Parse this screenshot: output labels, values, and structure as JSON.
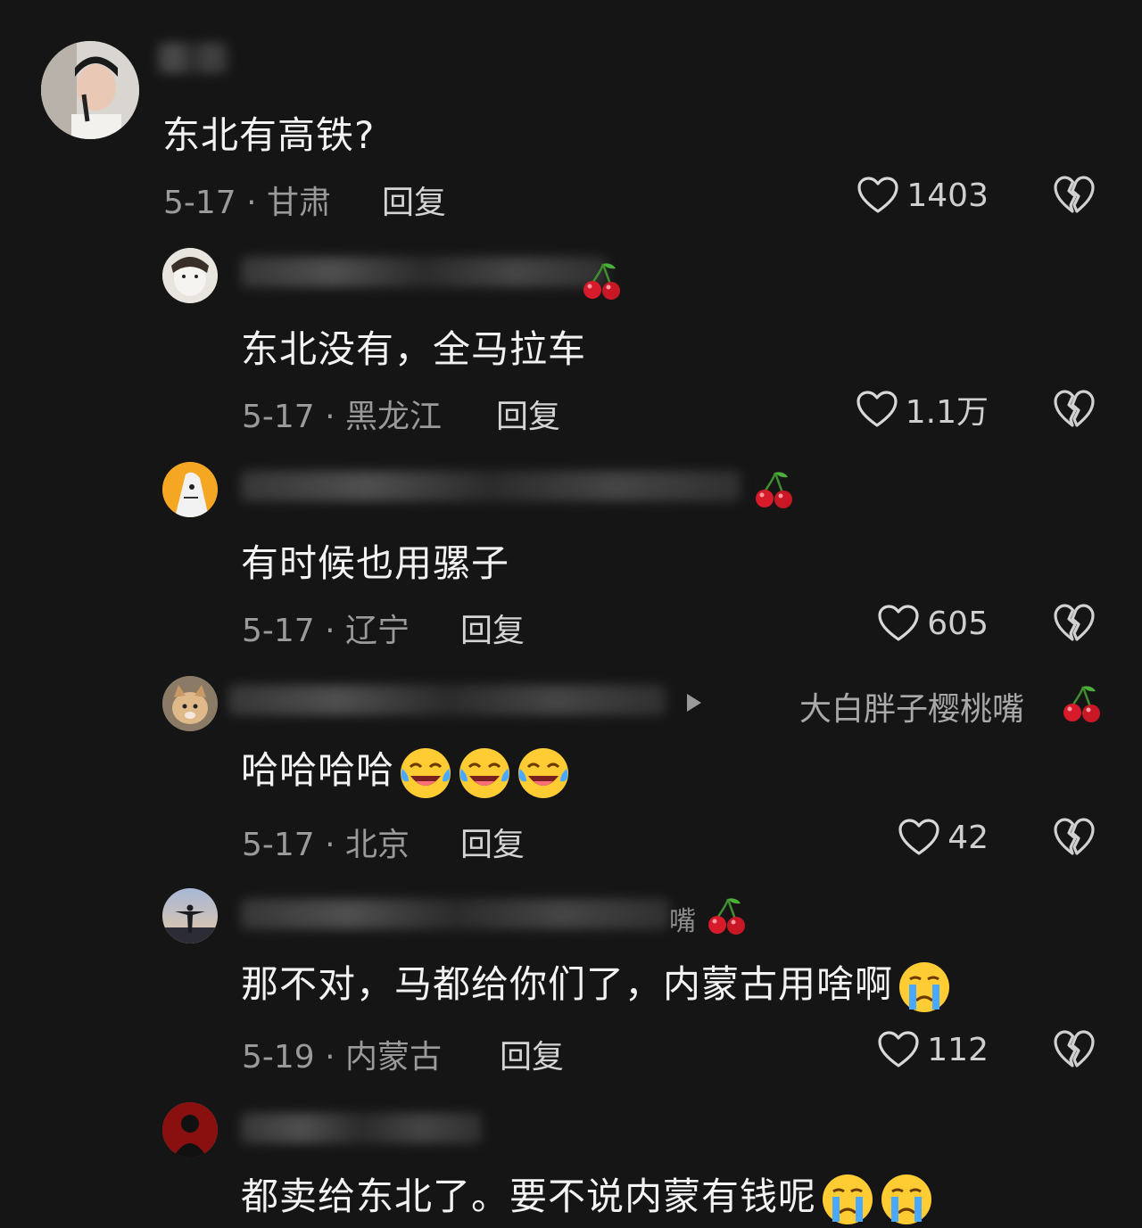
{
  "comments": [
    {
      "text": "东北有高铁?",
      "date_loc": "5-17 · 甘肃",
      "reply": "回复",
      "likes": "1403"
    },
    {
      "name_tail": "",
      "text": "东北没有，全马拉车",
      "date_loc": "5-17 · 黑龙江",
      "reply": "回复",
      "likes": "1.1万"
    },
    {
      "name_tail": "",
      "text": "有时候也用骡子",
      "date_loc": "5-17 · 辽宁",
      "reply": "回复",
      "likes": "605"
    },
    {
      "name_tail": "大白胖子樱桃嘴",
      "text": "哈哈哈哈",
      "date_loc": "5-17 · 北京",
      "reply": "回复",
      "likes": "42"
    },
    {
      "name_tail": "嘴",
      "text": "那不对，马都给你们了，内蒙古用啥啊",
      "date_loc": "5-19 · 内蒙古",
      "reply": "回复",
      "likes": "112"
    },
    {
      "text": "都卖给东北了。要不说内蒙有钱呢"
    }
  ],
  "icons": {
    "like": "heart-outline-icon",
    "dislike": "broken-heart-icon",
    "cherry": "cherry-emoji",
    "laugh_cry": "laughing-crying-emoji",
    "crying": "crying-face-emoji"
  },
  "colors": {
    "background": "#151515",
    "text": "#f2f2f2",
    "meta": "#9a9a9a"
  }
}
